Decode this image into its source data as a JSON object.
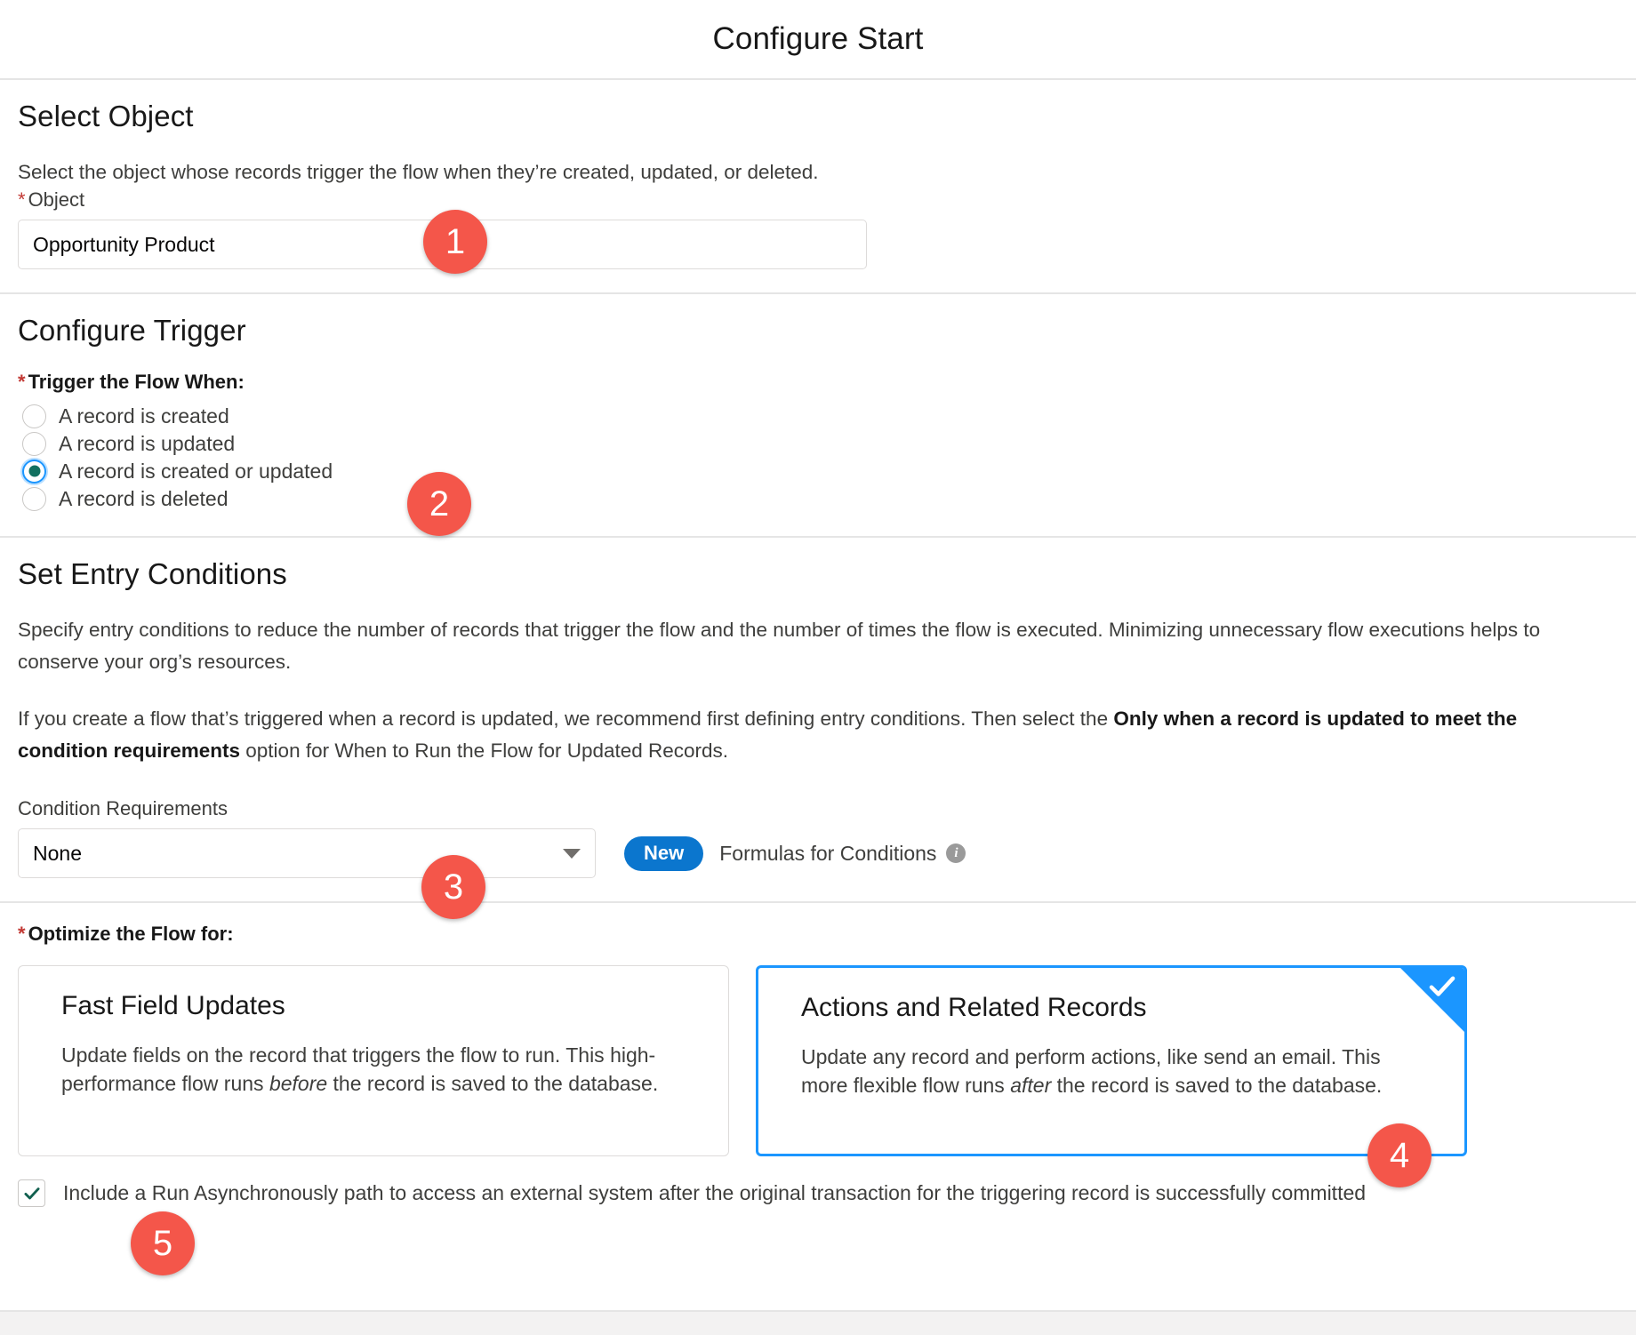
{
  "header": {
    "title": "Configure Start"
  },
  "select_object": {
    "heading": "Select Object",
    "description": "Select the object whose records trigger the flow when they’re created, updated, or deleted.",
    "field_label": "Object",
    "required_marker": "*",
    "value": "Opportunity Product"
  },
  "configure_trigger": {
    "heading": "Configure Trigger",
    "legend": "Trigger the Flow When:",
    "required_marker": "*",
    "options": [
      {
        "label": "A record is created",
        "selected": false
      },
      {
        "label": "A record is updated",
        "selected": false
      },
      {
        "label": "A record is created or updated",
        "selected": true
      },
      {
        "label": "A record is deleted",
        "selected": false
      }
    ]
  },
  "entry_conditions": {
    "heading": "Set Entry Conditions",
    "description_1": "Specify entry conditions to reduce the number of records that trigger the flow and the number of times the flow is executed. Minimizing unnecessary flow executions helps to conserve your org’s resources.",
    "description_2_part1": "If you create a flow that’s triggered when a record is updated, we recommend first defining entry conditions. Then select the ",
    "description_2_bold": "Only when a record is updated to meet the condition requirements",
    "description_2_part2": " option for When to Run the Flow for Updated Records.",
    "condition_label": "Condition Requirements",
    "condition_value": "None",
    "new_badge": "New",
    "formulas_label": "Formulas for Conditions",
    "info_glyph": "i"
  },
  "optimize": {
    "legend": "Optimize the Flow for:",
    "required_marker": "*",
    "cards": [
      {
        "title": "Fast Field Updates",
        "desc_part1": "Update fields on the record that triggers the flow to run. This high-performance flow runs ",
        "desc_emphasis": "before",
        "desc_part2": " the record is saved to the database.",
        "selected": false
      },
      {
        "title": "Actions and Related Records",
        "desc_part1": "Update any record and perform actions, like send an email. This more flexible flow runs ",
        "desc_emphasis": "after",
        "desc_part2": " the record is saved to the database.",
        "selected": true
      }
    ]
  },
  "async": {
    "label": "Include a Run Asynchronously path to access an external system after the original transaction for the triggering record is successfully committed",
    "checked": true
  },
  "annotations": [
    {
      "number": "1"
    },
    {
      "number": "2"
    },
    {
      "number": "3"
    },
    {
      "number": "4"
    },
    {
      "number": "5"
    }
  ],
  "colors": {
    "annotation_red": "#F4564A",
    "accent_blue": "#1B96FF",
    "badge_blue": "#0B76CE",
    "radio_green": "#12705F",
    "required_red": "#C23934",
    "border_gray": "#DDDBDA"
  }
}
